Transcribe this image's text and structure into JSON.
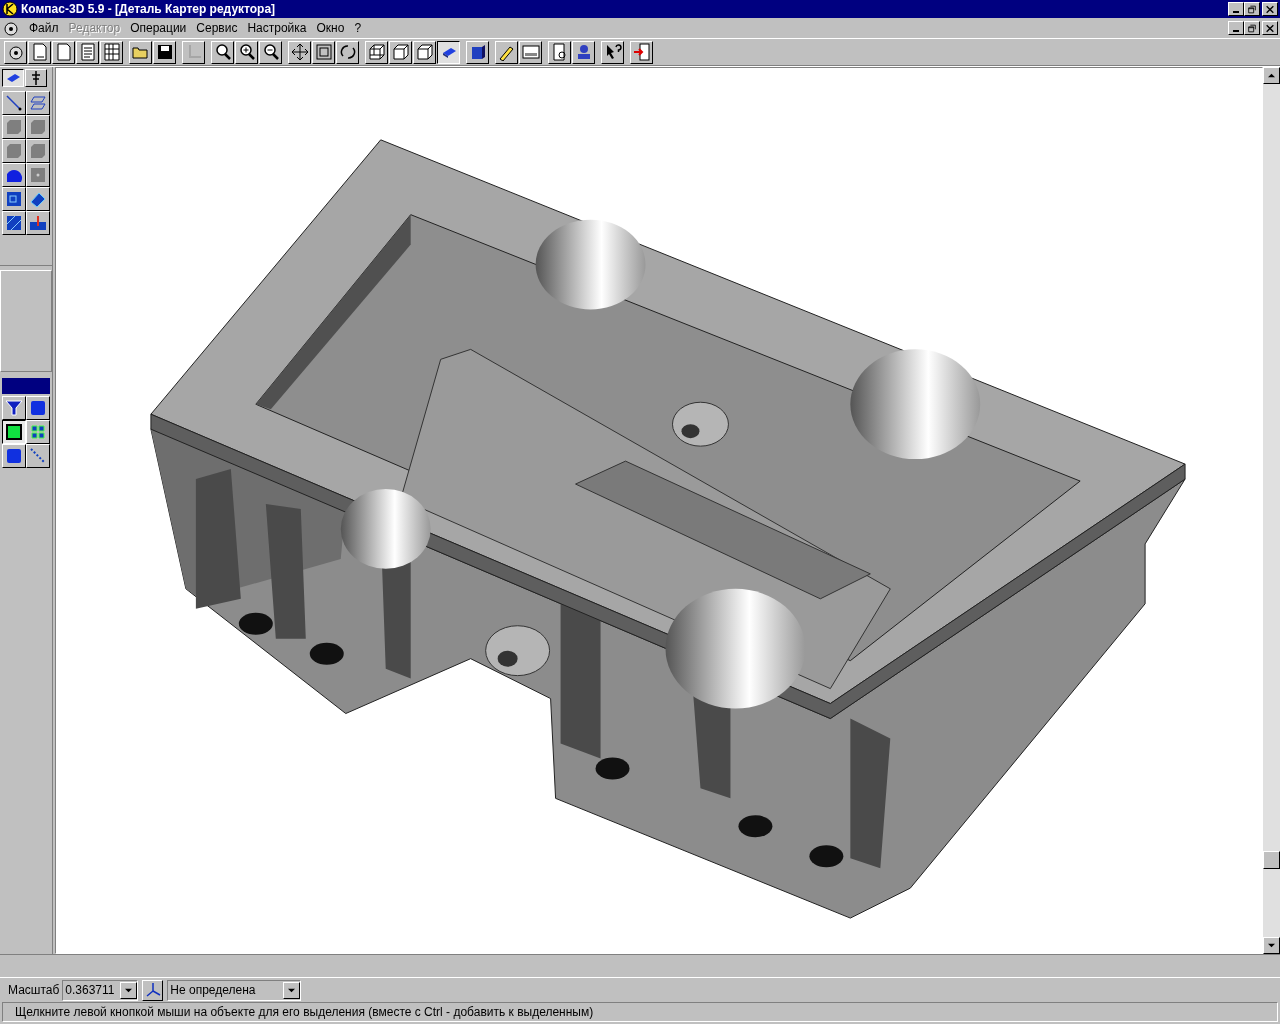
{
  "window": {
    "title": "Компас-3D 5.9 - [Деталь Картер редуктора]"
  },
  "menu": [
    {
      "label": "Файл",
      "disabled": false
    },
    {
      "label": "Редактор",
      "disabled": true
    },
    {
      "label": "Операции",
      "disabled": false
    },
    {
      "label": "Сервис",
      "disabled": false
    },
    {
      "label": "Настройка",
      "disabled": false
    },
    {
      "label": "Окно",
      "disabled": false
    },
    {
      "label": "?",
      "disabled": false
    }
  ],
  "toolbar": [
    [
      {
        "kind": "model",
        "selected": false,
        "disabled": false
      },
      {
        "kind": "sheet",
        "selected": false,
        "disabled": false
      },
      {
        "kind": "page",
        "selected": false,
        "disabled": false
      },
      {
        "kind": "text",
        "selected": false,
        "disabled": false
      },
      {
        "kind": "spec",
        "selected": false,
        "disabled": false
      }
    ],
    [
      {
        "kind": "open",
        "selected": false,
        "disabled": false
      },
      {
        "kind": "save",
        "selected": false,
        "disabled": false
      }
    ],
    [
      {
        "kind": "axes",
        "selected": false,
        "disabled": true
      }
    ],
    [
      {
        "kind": "zoom",
        "selected": false,
        "disabled": false
      },
      {
        "kind": "zoom-in",
        "selected": false,
        "disabled": false
      },
      {
        "kind": "zoom-out",
        "selected": false,
        "disabled": false
      }
    ],
    [
      {
        "kind": "pan",
        "selected": false,
        "disabled": false
      },
      {
        "kind": "fit",
        "selected": false,
        "disabled": false
      },
      {
        "kind": "rotate",
        "selected": false,
        "disabled": false
      }
    ],
    [
      {
        "kind": "wire",
        "selected": false,
        "disabled": false
      },
      {
        "kind": "hidden",
        "selected": false,
        "disabled": false
      },
      {
        "kind": "thin",
        "selected": false,
        "disabled": false
      },
      {
        "kind": "shaded",
        "selected": true,
        "disabled": false
      }
    ],
    [
      {
        "kind": "shaded-edges",
        "selected": false,
        "disabled": false
      }
    ],
    [
      {
        "kind": "pencil",
        "selected": false,
        "disabled": false
      },
      {
        "kind": "panel",
        "selected": false,
        "disabled": false
      }
    ],
    [
      {
        "kind": "preview",
        "selected": false,
        "disabled": false
      },
      {
        "kind": "stamp",
        "selected": false,
        "disabled": false
      }
    ],
    [
      {
        "kind": "help",
        "selected": false,
        "disabled": false
      }
    ],
    [
      {
        "kind": "exit",
        "selected": false,
        "disabled": false
      }
    ]
  ],
  "palette_tabs": [
    {
      "kind": "solid",
      "selected": true
    },
    {
      "kind": "pin",
      "selected": false
    }
  ],
  "palette": [
    {
      "kind": "line"
    },
    {
      "kind": "plane"
    },
    {
      "kind": "chamfer"
    },
    {
      "kind": "chamfer"
    },
    {
      "kind": "chamfer"
    },
    {
      "kind": "chamfer"
    },
    {
      "kind": "round"
    },
    {
      "kind": "dot"
    },
    {
      "kind": "box"
    },
    {
      "kind": "extrude"
    },
    {
      "kind": "hatch"
    },
    {
      "kind": "cut"
    }
  ],
  "filter_palette": [
    {
      "kind": "filter",
      "selected": false
    },
    {
      "kind": "cube",
      "selected": false
    },
    {
      "kind": "face",
      "selected": true
    },
    {
      "kind": "grid",
      "selected": false
    },
    {
      "kind": "cube",
      "selected": false
    },
    {
      "kind": "dashed",
      "selected": false
    }
  ],
  "scale": {
    "label": "Масштаб",
    "value": "0.363711"
  },
  "orientation": {
    "value": "Не определена"
  },
  "status_bar": "Щелкните левой кнопкой мыши на объекте для его выделения (вместе с Ctrl - добавить к выделенным)"
}
